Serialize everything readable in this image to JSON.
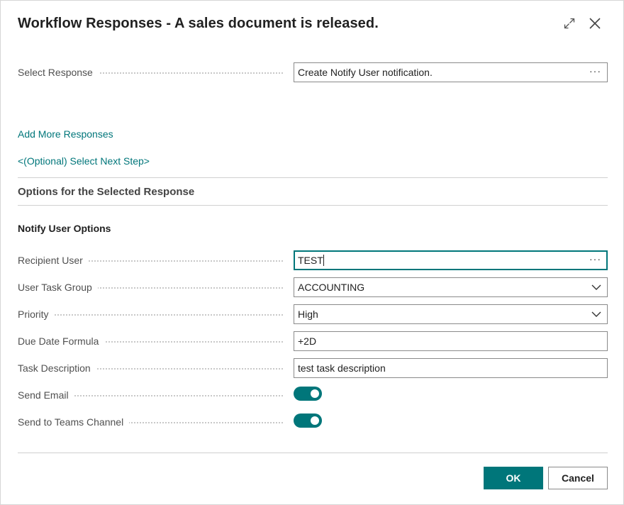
{
  "dialog": {
    "title": "Workflow Responses - A sales document is released."
  },
  "select_response": {
    "label": "Select Response",
    "value": "Create Notify User notification.",
    "lookup": "···"
  },
  "links": {
    "add_more": "Add More Responses",
    "next_step": "<(Optional) Select Next Step>"
  },
  "options_section": {
    "title": "Options for the Selected Response",
    "subtitle": "Notify User Options",
    "fields": {
      "recipient_user": {
        "label": "Recipient User",
        "value": "TEST",
        "lookup": "···"
      },
      "user_task_group": {
        "label": "User Task Group",
        "value": "ACCOUNTING"
      },
      "priority": {
        "label": "Priority",
        "value": "High"
      },
      "due_date_formula": {
        "label": "Due Date Formula",
        "value": "+2D"
      },
      "task_description": {
        "label": "Task Description",
        "value": "test task description"
      },
      "send_email": {
        "label": "Send Email",
        "on": true
      },
      "send_to_teams": {
        "label": "Send to Teams Channel",
        "on": true
      }
    }
  },
  "buttons": {
    "ok": "OK",
    "cancel": "Cancel"
  },
  "colors": {
    "accent": "#00767a",
    "text": "#212121",
    "label": "#505050",
    "border": "#8a8a8a"
  },
  "icons": {
    "expand": "expand-icon",
    "close": "close-icon",
    "chevron": "chevron-down-icon"
  }
}
